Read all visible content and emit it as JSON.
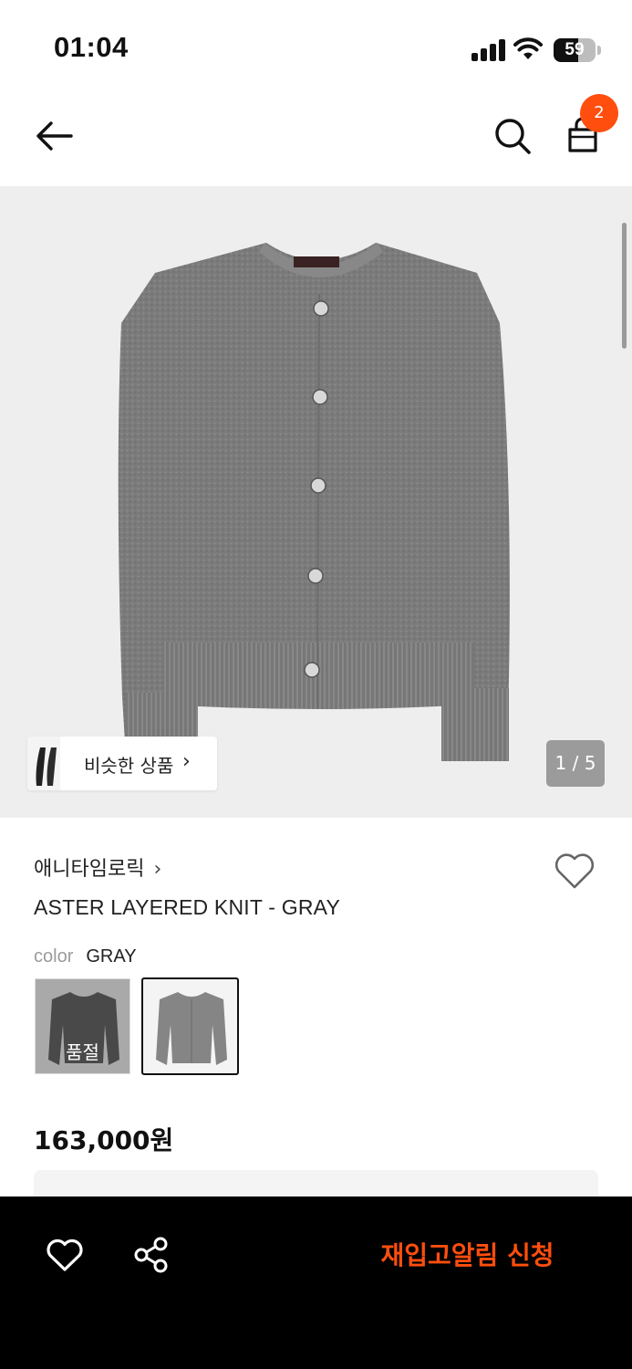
{
  "status_bar": {
    "time": "01:04",
    "battery": "59",
    "battery_level": 0.59
  },
  "header": {
    "cart_count": "2",
    "icons": [
      "back-arrow-icon",
      "search-icon",
      "shopping-bag-icon"
    ]
  },
  "gallery": {
    "similar_label": "비슷한 상품",
    "similar_chevron": "›",
    "page_indicator": "1 / 5"
  },
  "product": {
    "brand": "애니타임로릭",
    "brand_chevron": "›",
    "name": "ASTER LAYERED KNIT - GRAY",
    "color_key": "color",
    "color_value": "GRAY",
    "swatches": [
      {
        "color": "BLACK",
        "sold_out_label": "품절"
      },
      {
        "color": "GRAY",
        "selected": true
      }
    ],
    "price": "163,000원"
  },
  "bottom_bar": {
    "restock_label": "재입고알림 신청",
    "accent": "#ff4e0e"
  }
}
